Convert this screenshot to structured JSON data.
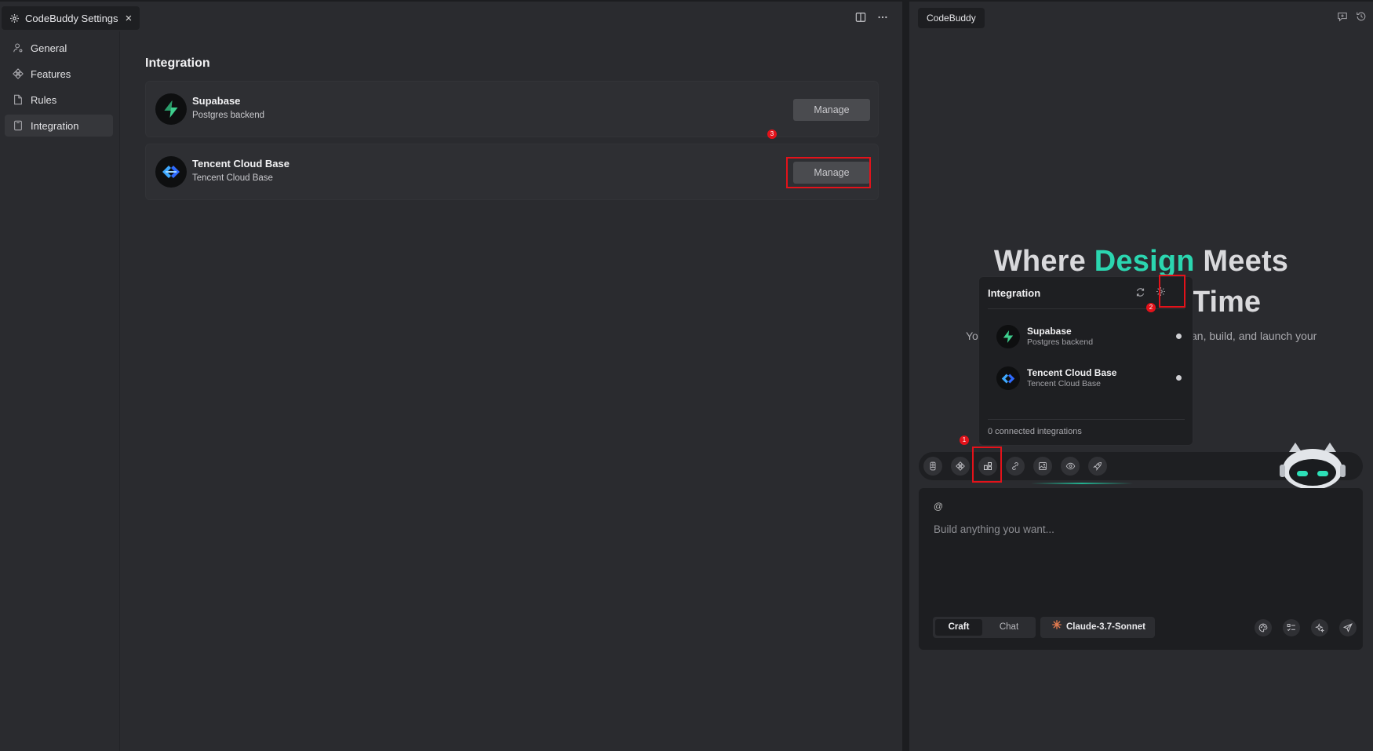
{
  "editor": {
    "tab_title": "CodeBuddy Settings",
    "tab_close": "×",
    "actions": [
      "split-editor-icon",
      "more-icon"
    ]
  },
  "sidebar": {
    "items": [
      {
        "label": "General",
        "icon": "user-gear-icon",
        "active": false
      },
      {
        "label": "Features",
        "icon": "features-icon",
        "active": false
      },
      {
        "label": "Rules",
        "icon": "document-icon",
        "active": false
      },
      {
        "label": "Integration",
        "icon": "integration-icon",
        "active": true
      }
    ]
  },
  "content": {
    "title": "Integration",
    "integrations": [
      {
        "name": "Supabase",
        "description": "Postgres backend",
        "button": "Manage",
        "logo": "supabase-logo-icon"
      },
      {
        "name": "Tencent Cloud Base",
        "description": "Tencent Cloud Base",
        "button": "Manage",
        "logo": "tencent-cloudbase-logo-icon"
      }
    ]
  },
  "annotations": {
    "badge1": "1",
    "badge2": "2",
    "badge3": "3"
  },
  "codebuddy": {
    "tab_title": "CodeBuddy",
    "hero": {
      "word1": "Where ",
      "accent": "Design",
      "word3": " Meets",
      "line2": "Time",
      "sub_left": "Yo",
      "sub_right": "an, build, and launch your"
    },
    "popup": {
      "title": "Integration",
      "items": [
        {
          "name": "Supabase",
          "description": "Postgres backend"
        },
        {
          "name": "Tencent Cloud Base",
          "description": "Tencent Cloud Base"
        }
      ],
      "footer": "0 connected integrations"
    },
    "toolbar": [
      "figma-icon",
      "components-icon",
      "integration-icon",
      "link-icon",
      "image-icon",
      "preview-icon",
      "deploy-rocket-icon"
    ],
    "input": {
      "at_symbol": "@",
      "placeholder": "Build anything you want...",
      "modes": [
        "Craft",
        "Chat"
      ],
      "active_mode": "Craft",
      "model": "Claude-3.7-Sonnet"
    }
  },
  "colors": {
    "accent": "#2bd6b0",
    "annotation_red": "#e3121a",
    "background": "#2a2b2f"
  }
}
